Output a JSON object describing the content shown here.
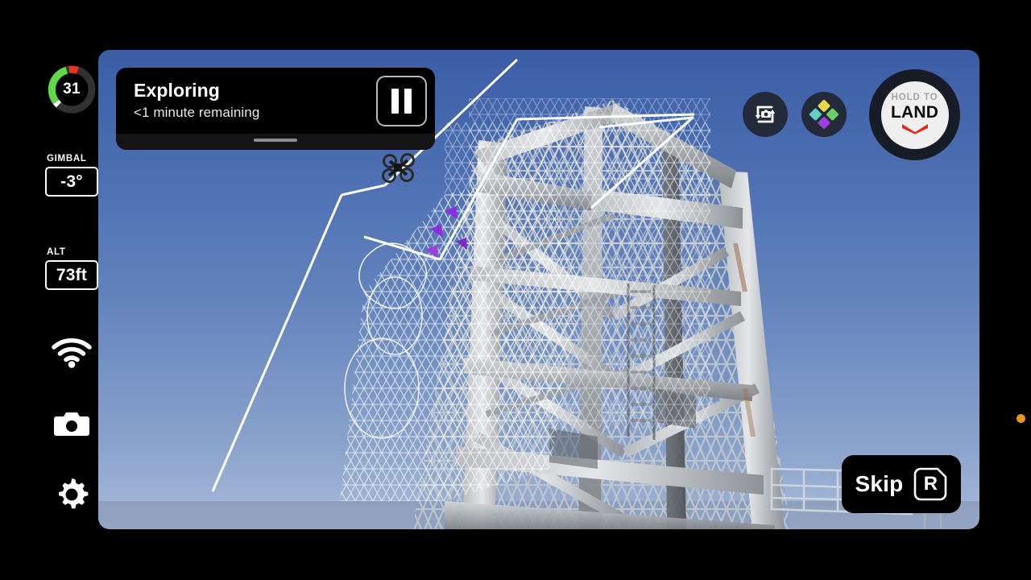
{
  "app": {
    "name": "drone-flight-control",
    "view": "scan-mission-live-view"
  },
  "colors": {
    "panel_black": "#000000",
    "card_black": "#000000",
    "battery_green": "#5fd84a",
    "battery_red": "#e8321c",
    "battery_track": "#323232",
    "accent_orange": "#e8941f",
    "land_red": "#e02b1e",
    "button_navy": "#232a3a",
    "mode_yellow": "#e8d94a",
    "mode_teal": "#63cfc6",
    "mode_green": "#6dcf63",
    "mode_purple": "#9a3fdb",
    "marker_purple": "#8b2fe0",
    "sky_top": "#3b5da6",
    "sky_bottom": "#a8bad8"
  },
  "sidebar": {
    "battery": {
      "name": "battery-indicator",
      "percent": 31,
      "percent_label": "31",
      "charge_arc_deg": 112,
      "warning_arc_deg": 26
    },
    "readouts": [
      {
        "name": "gimbal",
        "label": "GIMBAL",
        "value": "-3°"
      },
      {
        "name": "altitude",
        "label": "ALT",
        "value": "73ft"
      }
    ],
    "icons": [
      {
        "name": "wifi-icon",
        "label": "wifi"
      },
      {
        "name": "camera-icon",
        "label": "camera"
      },
      {
        "name": "gear-icon",
        "label": "settings"
      }
    ]
  },
  "status_card": {
    "title": "Exploring",
    "subtitle": "<1 minute remaining",
    "pause_label": "pause",
    "handle_label": "drag-handle"
  },
  "top_controls": {
    "switch_camera": {
      "label": "switch-camera"
    },
    "modes": {
      "label": "modes"
    },
    "hold_to_land": {
      "top_label": "HOLD TO",
      "main_label": "LAND"
    }
  },
  "skip": {
    "label": "Skip",
    "key": "R"
  },
  "overlay": {
    "recording_dot": "recording",
    "drone_marker": "drone-position-icon",
    "mesh_label": "scan-mesh-overlay",
    "path_label": "flight-path"
  }
}
